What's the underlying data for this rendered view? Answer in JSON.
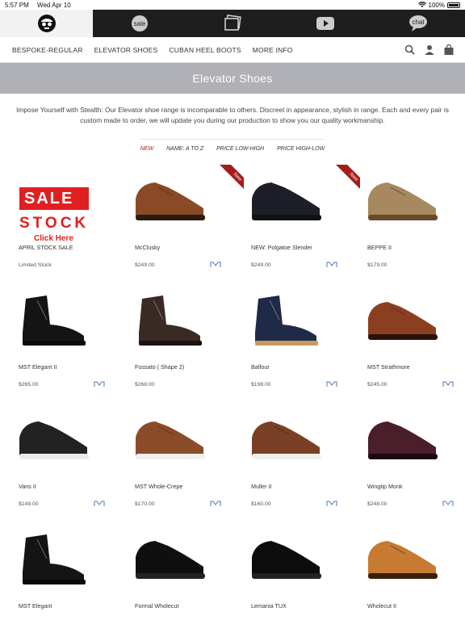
{
  "status": {
    "time": "5:57 PM",
    "date": "Wed Apr 10",
    "battery": "100%"
  },
  "topnav": {
    "tabs": [
      {
        "icon": "skull-logo-icon"
      },
      {
        "icon": "sale-tag-icon",
        "label": "sale"
      },
      {
        "icon": "photos-icon"
      },
      {
        "icon": "youtube-play-icon"
      },
      {
        "icon": "chat-bubble-icon",
        "label": "chat"
      }
    ]
  },
  "menu": {
    "items": [
      "BESPOKE-REGULAR",
      "ELEVATOR SHOES",
      "CUBAN HEEL BOOTS",
      "MORE INFO"
    ]
  },
  "page": {
    "title": "Elevator Shoes",
    "intro": "Impose Yourself with Stealth: Our Elevator shoe range is incomparable to others. Discreet in appearance, stylish in range. Each and every pair is custom made to order, we will update you during our production to show you our quality workmanship."
  },
  "sort": {
    "options": [
      "NEW",
      "NAME: A TO Z",
      "PRICE LOW-HIGH",
      "PRICE HIGH-LOW"
    ],
    "active": 0
  },
  "promo": {
    "sale": "SALE",
    "stock": "STOCK",
    "click": "Click Here"
  },
  "ribbon_label": "New",
  "products": [
    {
      "name": "APRIL STOCK SALE",
      "price": "Limited Stock",
      "style": "sale"
    },
    {
      "name": "McClusky",
      "price": "$249.00",
      "style": "oxford-brown",
      "isNew": true,
      "hasLogo": true
    },
    {
      "name": "NEW: Polgatoe Slender",
      "price": "$249.00",
      "style": "oxford-black",
      "isNew": true,
      "hasLogo": true
    },
    {
      "name": "BEPPE II",
      "price": "$179.00",
      "style": "suede-tan"
    },
    {
      "name": "MST Elegant II",
      "price": "$265.00",
      "style": "boot-black",
      "hasLogo": true
    },
    {
      "name": "Fossato ( Shape 2)",
      "price": "$268.00",
      "style": "boot-dark"
    },
    {
      "name": "Balfour",
      "price": "$198.00",
      "style": "boot-navy",
      "hasLogo": true
    },
    {
      "name": "MST Strathmore",
      "price": "$245.00",
      "style": "monk-brown",
      "hasLogo": true
    },
    {
      "name": "Vans II",
      "price": "$149.00",
      "style": "slipon-black",
      "hasLogo": true
    },
    {
      "name": "MST Whole-Crepe",
      "price": "$170.00",
      "style": "oxford-tan-white",
      "hasLogo": true
    },
    {
      "name": "Muller II",
      "price": "$160.00",
      "style": "oxford-brown-white",
      "hasLogo": true
    },
    {
      "name": "Wingtip Monk",
      "price": "$248.00",
      "style": "monk-burgundy",
      "hasLogo": true
    },
    {
      "name": "MST Elegant",
      "price": "",
      "style": "boot-black"
    },
    {
      "name": "Formal Wholecut",
      "price": "",
      "style": "wholecut-black"
    },
    {
      "name": "Lemania TUX",
      "price": "",
      "style": "tux-black"
    },
    {
      "name": "Wholecut II",
      "price": "",
      "style": "wholecut-tan"
    }
  ]
}
